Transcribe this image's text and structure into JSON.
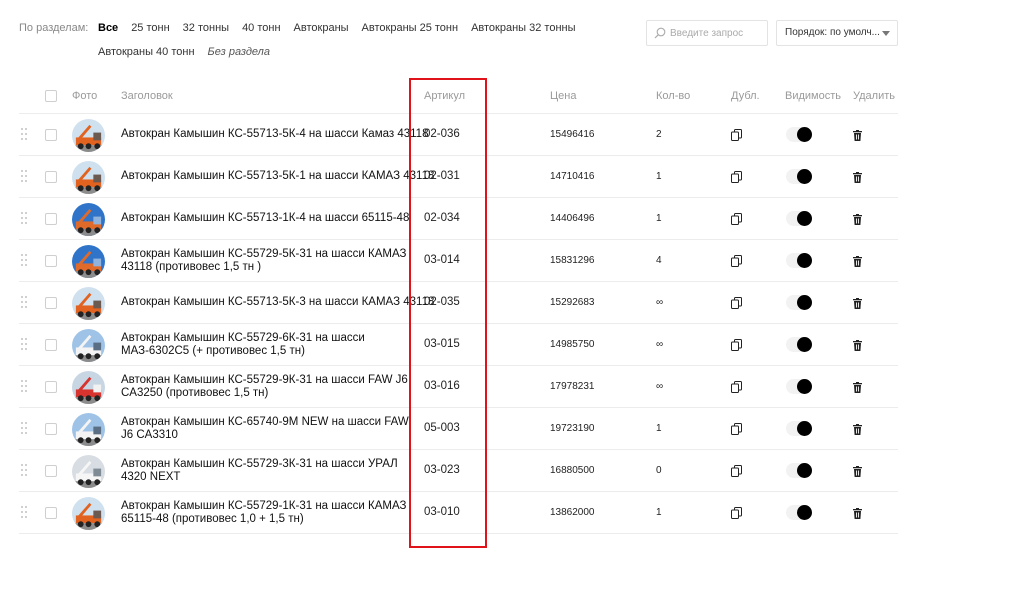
{
  "filters": {
    "label": "По разделам:",
    "row1": [
      "Все",
      "25 тонн",
      "32 тонны",
      "40 тонн",
      "Автокраны",
      "Автокраны 25 тонн",
      "Автокраны 32 тонны"
    ],
    "row2": [
      "Автокраны 40 тонн",
      "Без раздела"
    ],
    "active_index": 0
  },
  "search": {
    "placeholder": "Введите запрос",
    "value": ""
  },
  "sort": {
    "label": "Порядок: по умолч..."
  },
  "columns": {
    "photo": "Фото",
    "title": "Заголовок",
    "sku": "Артикул",
    "price": "Цена",
    "qty": "Кол-во",
    "dup": "Дубл.",
    "visibility": "Видимость",
    "delete": "Удалить"
  },
  "products": [
    {
      "title": "Автокран Камышин КС-55713-5К-4 на шасси Камаз 43118",
      "sku": "02-036",
      "price": "15496416",
      "qty": "2",
      "visible": true,
      "thumb": "truck-orange"
    },
    {
      "title": "Автокран Камышин КС-55713-5К-1 на шасси КАМАЗ 43118",
      "sku": "02-031",
      "price": "14710416",
      "qty": "1",
      "visible": true,
      "thumb": "truck-orange"
    },
    {
      "title": "Автокран Камышин КС-55713-1К-4 на шасси 65115-48",
      "sku": "02-034",
      "price": "14406496",
      "qty": "1",
      "visible": true,
      "thumb": "crane-blue-sky"
    },
    {
      "title": "Автокран Камышин КС-55729-5К-31 на шасси КАМАЗ 43118 (противовес 1,5 тн )",
      "sku": "03-014",
      "price": "15831296",
      "qty": "4",
      "visible": true,
      "thumb": "crane-blue-sky"
    },
    {
      "title": "Автокран Камышин КС-55713-5К-3 на шасси КАМАЗ 43118",
      "sku": "02-035",
      "price": "15292683",
      "qty": "∞",
      "visible": true,
      "thumb": "truck-orange"
    },
    {
      "title": "Автокран Камышин КС-55729-6К-31 на шасси МАЗ-6302С5 (+ противовес 1,5 тн)",
      "sku": "03-015",
      "price": "14985750",
      "qty": "∞",
      "visible": true,
      "thumb": "truck-white-blue"
    },
    {
      "title": "Автокран Камышин КС-55729-9К-31 на шасси FAW J6 CA3250 (противовес 1,5 тн)",
      "sku": "03-016",
      "price": "17978231",
      "qty": "∞",
      "visible": true,
      "thumb": "truck-red"
    },
    {
      "title": "Автокран Камышин КС-65740-9М NEW на шасси FAW J6 CA3310",
      "sku": "05-003",
      "price": "19723190",
      "qty": "1",
      "visible": true,
      "thumb": "truck-white-blue"
    },
    {
      "title": "Автокран Камышин КС-55729-3К-31 на шасси УРАЛ 4320 NEXT",
      "sku": "03-023",
      "price": "16880500",
      "qty": "0",
      "visible": true,
      "thumb": "truck-white"
    },
    {
      "title": "Автокран Камышин КС-55729-1К-31 на шасси КАМАЗ 65115-48 (противовес 1,0 + 1,5 тн)",
      "sku": "03-010",
      "price": "13862000",
      "qty": "1",
      "visible": true,
      "thumb": "truck-orange"
    }
  ],
  "thumb_palettes": {
    "truck-orange": [
      "#cfe0ee",
      "#e2621f",
      "#6a5a52"
    ],
    "crane-blue-sky": [
      "#2f74c8",
      "#e06a2a",
      "#8fb3dc"
    ],
    "truck-white-blue": [
      "#9fc3e6",
      "#f4f4f4",
      "#5b6f84"
    ],
    "truck-red": [
      "#c8d6e3",
      "#d8342f",
      "#f2f2f2"
    ],
    "truck-white": [
      "#d7dde3",
      "#f6f6f6",
      "#7f8c96"
    ]
  },
  "highlight_color": "#e0121a"
}
